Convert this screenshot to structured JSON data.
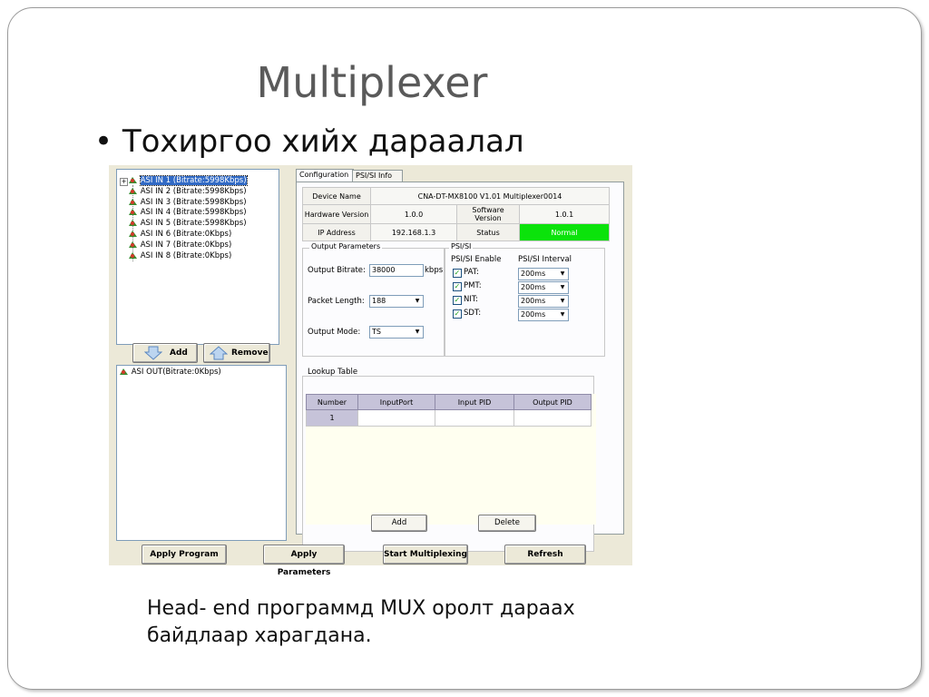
{
  "slide": {
    "title": "Multiplexer",
    "bullet": "• Тохиргоо хийх дараалал",
    "caption_line1": "Head- end программд MUX оролт дараах",
    "caption_line2": "байдлаар харагдана."
  },
  "input_tree": {
    "items": [
      {
        "label": "ASI IN 1  (Bitrate:5998Kbps)"
      },
      {
        "label": "ASI IN 2  (Bitrate:5998Kbps)"
      },
      {
        "label": "ASI IN 3  (Bitrate:5998Kbps)"
      },
      {
        "label": "ASI IN 4  (Bitrate:5998Kbps)"
      },
      {
        "label": "ASI IN 5  (Bitrate:5998Kbps)"
      },
      {
        "label": "ASI IN 6  (Bitrate:0Kbps)"
      },
      {
        "label": "ASI IN 7  (Bitrate:0Kbps)"
      },
      {
        "label": "ASI IN 8  (Bitrate:0Kbps)"
      }
    ],
    "expand": "+"
  },
  "buttons": {
    "add": "Add",
    "remove": "Remove",
    "apply_program": "Apply Program",
    "apply_parameters": "Apply Parameters",
    "start_multiplexing": "Start Multiplexing",
    "refresh": "Refresh",
    "lookup_add": "Add",
    "lookup_delete": "Delete"
  },
  "output_tree": {
    "item": "ASI OUT(Bitrate:0Kbps)"
  },
  "tabs": [
    "Configuration",
    "PSI/SI Info"
  ],
  "device": {
    "device_name_label": "Device Name",
    "device_name": "CNA-DT-MX8100  V1.01 Multiplexer0014",
    "hw_label": "Hardware Version",
    "hw": "1.0.0",
    "sw_label": "Software Version",
    "sw": "1.0.1",
    "ip_label": "IP Address",
    "ip": "192.168.1.3",
    "status_label": "Status",
    "status": "Normal",
    "status_color": "#0be30b"
  },
  "output_params": {
    "group_label": "Output Parameters",
    "bitrate_label": "Output Bitrate:",
    "bitrate": "38000",
    "bitrate_unit": "kbps",
    "packet_label": "Packet Length:",
    "packet": "188",
    "mode_label": "Output Mode:",
    "mode": "TS"
  },
  "psi": {
    "group_label": "PSI/SI",
    "enable_header": "PSI/SI Enable",
    "interval_header": "PSI/SI Interval",
    "rows": [
      {
        "name": "PAT:",
        "interval": "200ms",
        "checked": "✓"
      },
      {
        "name": "PMT:",
        "interval": "200ms",
        "checked": "✓"
      },
      {
        "name": "NIT:",
        "interval": "200ms",
        "checked": "✓"
      },
      {
        "name": "SDT:",
        "interval": "200ms",
        "checked": "✓"
      }
    ]
  },
  "lookup": {
    "label": "Lookup Table",
    "columns": [
      "Number",
      "InputPort",
      "Input PID",
      "Output PID"
    ],
    "rows": [
      {
        "number": "1",
        "input_port": "",
        "input_pid": "",
        "output_pid": ""
      }
    ]
  }
}
